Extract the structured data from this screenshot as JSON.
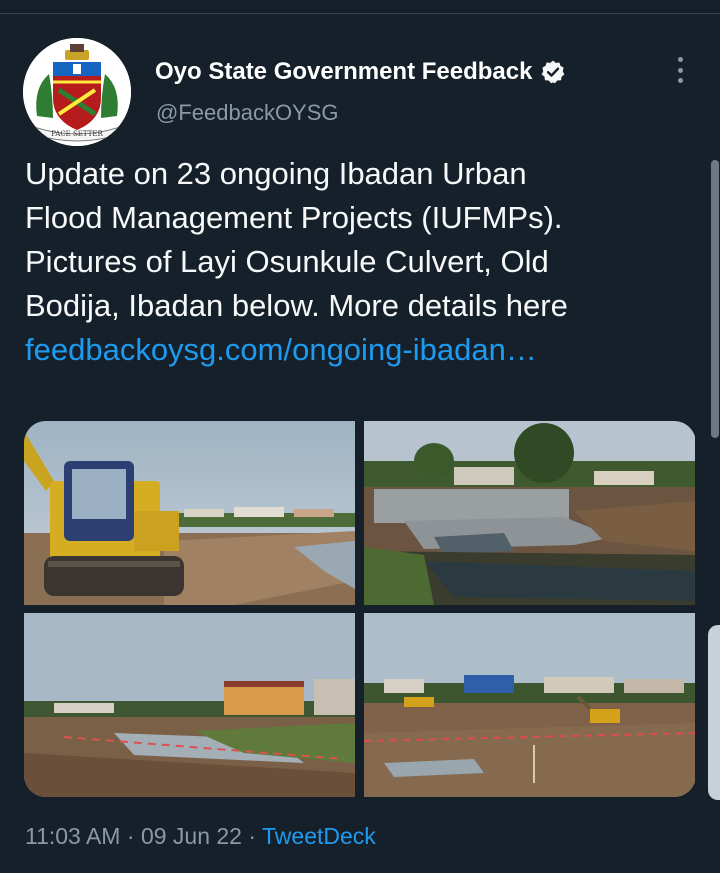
{
  "tweet": {
    "author_name": "Oyo State Government Feedback",
    "author_handle": "@FeedbackOYSG",
    "avatar_motto": "PACE SETTER",
    "text_lines": [
      "Update on 23 ongoing Ibadan Urban",
      "Flood Management Projects (IUFMPs).",
      "Pictures of Layi Osunkule Culvert, Old",
      "Bodija, Ibadan below. More details here"
    ],
    "link_text": "feedbackoysg.com/ongoing-ibadan…",
    "time": "11:03 AM",
    "date": "09 Jun 22",
    "separator": "·",
    "source": "TweetDeck"
  },
  "media": {
    "photos": [
      {
        "subject": "excavator-on-site"
      },
      {
        "subject": "concrete-culvert"
      },
      {
        "subject": "excavated-channel-with-buildings"
      },
      {
        "subject": "construction-site-with-excavator"
      }
    ]
  },
  "icons": {
    "verified": "verified-badge-icon",
    "more": "more-options-icon"
  },
  "colors": {
    "background": "#15202b",
    "link": "#1d9bf0",
    "secondary_text": "#8b98a5"
  }
}
